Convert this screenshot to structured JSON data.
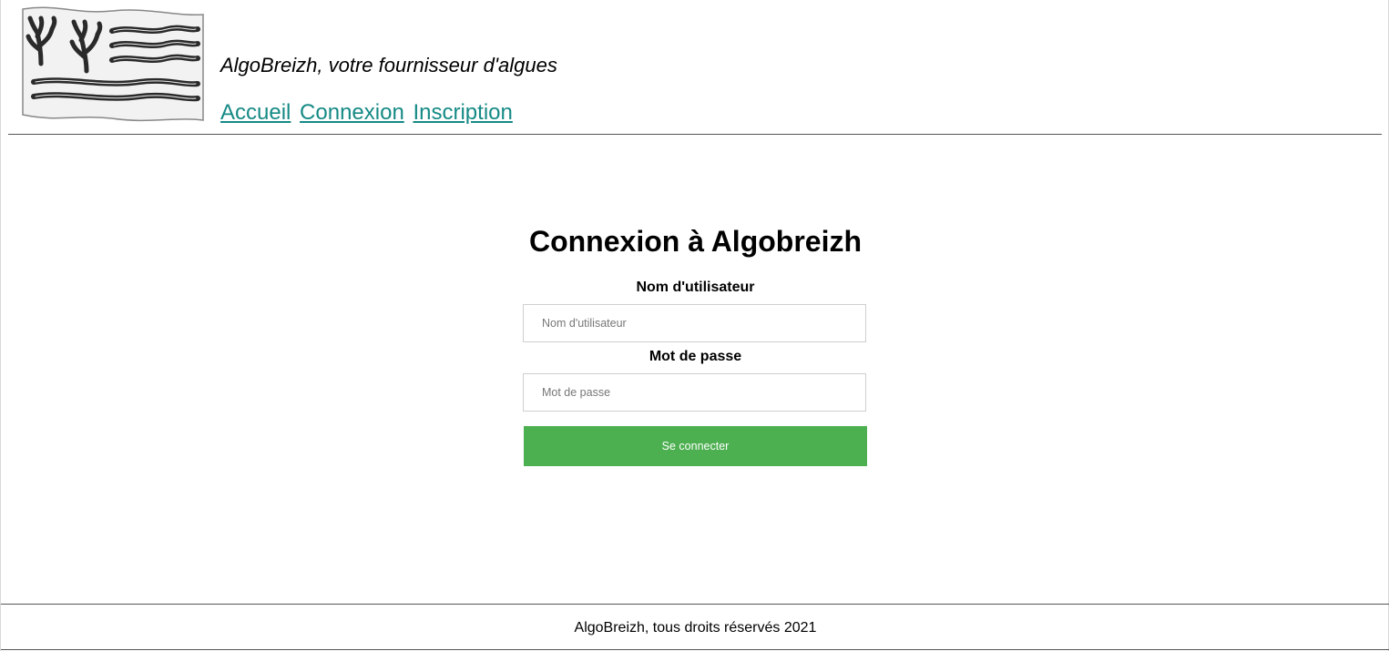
{
  "header": {
    "logo_name": "flag-logo",
    "tagline": "AlgoBreizh, votre fournisseur d'algues",
    "nav": [
      {
        "label": "Accueil"
      },
      {
        "label": "Connexion"
      },
      {
        "label": "Inscription"
      }
    ],
    "link_color": "#168a85"
  },
  "login": {
    "title": "Connexion à Algobreizh",
    "username_label": "Nom d'utilisateur",
    "username_placeholder": "Nom d'utilisateur",
    "username_value": "",
    "password_label": "Mot de passe",
    "password_placeholder": "Mot de passe",
    "password_value": "",
    "submit_label": "Se connecter",
    "submit_color": "#4caf50"
  },
  "footer": {
    "text": "AlgoBreizh, tous droits réservés 2021"
  }
}
